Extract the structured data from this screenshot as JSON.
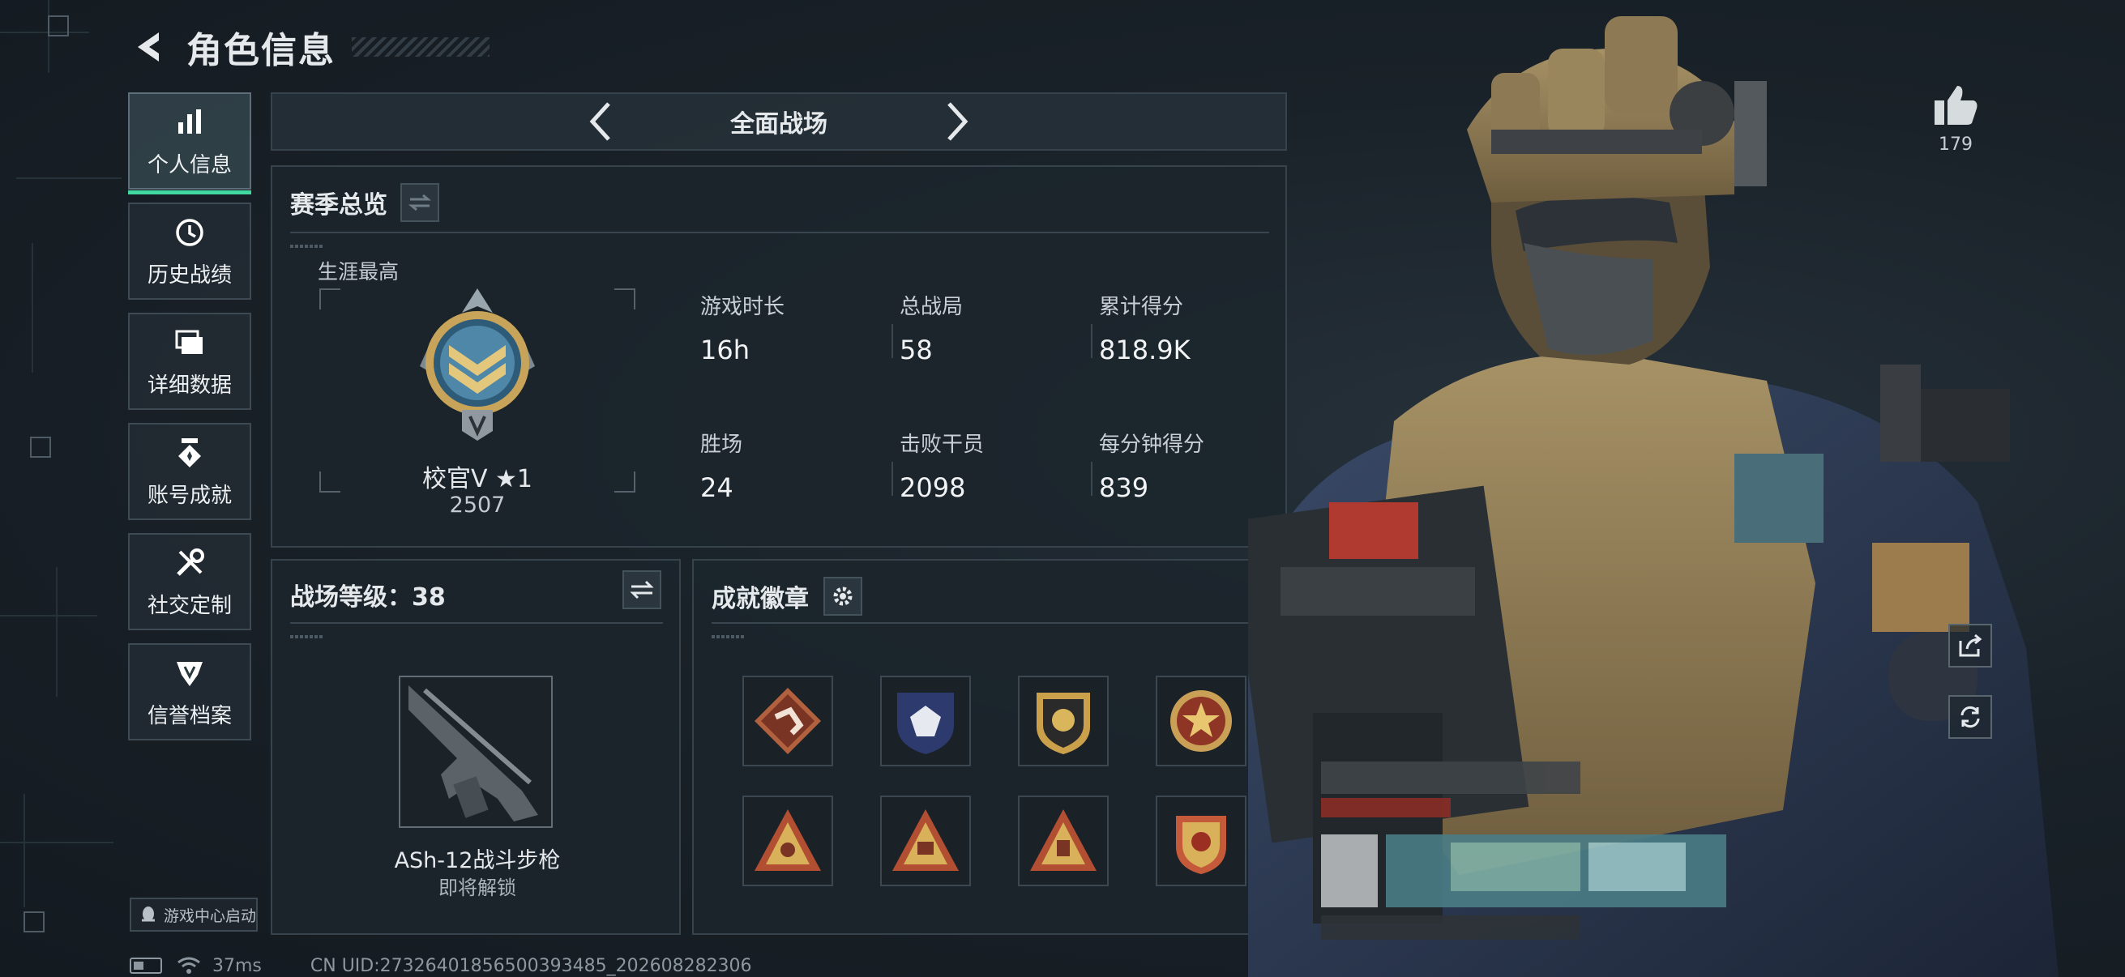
{
  "header": {
    "title": "角色信息"
  },
  "sidebar": {
    "items": [
      {
        "label": "个人信息",
        "icon": "bar-chart-icon",
        "active": true
      },
      {
        "label": "历史战绩",
        "icon": "history-clock-icon"
      },
      {
        "label": "详细数据",
        "icon": "folders-icon"
      },
      {
        "label": "账号成就",
        "icon": "achievement-icon"
      },
      {
        "label": "社交定制",
        "icon": "tools-icon"
      },
      {
        "label": "信誉档案",
        "icon": "shield-wing-icon"
      }
    ],
    "launch_badge": "游戏中心启动"
  },
  "mode": {
    "title": "全面战场"
  },
  "season": {
    "title": "赛季总览",
    "career_label": "生涯最高",
    "rank_name": "校官V ★1",
    "rank_score": "2507",
    "stats": [
      {
        "label": "游戏时长",
        "value": "16h"
      },
      {
        "label": "总战局",
        "value": "58"
      },
      {
        "label": "累计得分",
        "value": "818.9K"
      },
      {
        "label": "胜场",
        "value": "24"
      },
      {
        "label": "击败干员",
        "value": "2098"
      },
      {
        "label": "每分钟得分",
        "value": "839"
      }
    ]
  },
  "level": {
    "title": "战场等级：38",
    "weapon_name": "ASh-12战斗步枪",
    "weapon_state": "即将解锁"
  },
  "badges": {
    "title": "成就徽章"
  },
  "social": {
    "likes": "179"
  },
  "status": {
    "ping": "37ms",
    "uid": "CN UID:27326401856500393485_202608282306"
  },
  "colors": {
    "accent": "#3fd9a1",
    "panel": "#1c252c",
    "border": "#36434c"
  }
}
